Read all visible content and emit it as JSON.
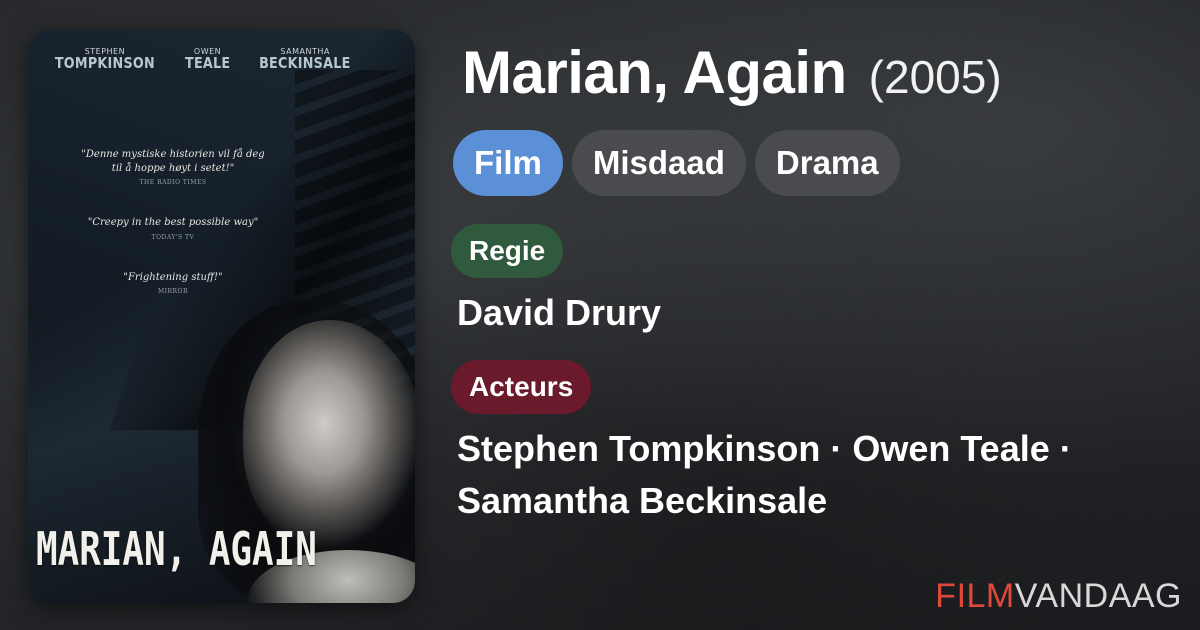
{
  "movie": {
    "title": "Marian, Again",
    "year": "(2005)"
  },
  "genres": [
    "Film",
    "Misdaad",
    "Drama"
  ],
  "colors": {
    "primary_chip": "#5b8fd6",
    "secondary_chip": "#4a4b4e",
    "director_badge": "#2f5a3d",
    "cast_badge": "#6a1a2a",
    "brand_red": "#e0483c"
  },
  "director": {
    "label": "Regie",
    "name": "David Drury"
  },
  "cast": {
    "label": "Acteurs",
    "line1": "Stephen Tompkinson · Owen Teale ·",
    "line2": "Samantha Beckinsale"
  },
  "poster": {
    "credits": [
      {
        "first": "STEPHEN",
        "last": "TOMPKINSON"
      },
      {
        "first": "OWEN",
        "last": "TEALE"
      },
      {
        "first": "SAMANTHA",
        "last": "BECKINSALE"
      }
    ],
    "quotes": [
      {
        "text": "\"Denne mystiske historien vil få deg til å hoppe høyt i setet!\"",
        "source": "THE RADIO TIMES"
      },
      {
        "text": "\"Creepy in the best possible way\"",
        "source": "TODAY'S TV"
      },
      {
        "text": "\"Frightening stuff!\"",
        "source": "MIRROR"
      }
    ],
    "title": "MARIAN, AGAIN"
  },
  "brand": {
    "part1": "FILM",
    "part2": "VANDAAG"
  }
}
